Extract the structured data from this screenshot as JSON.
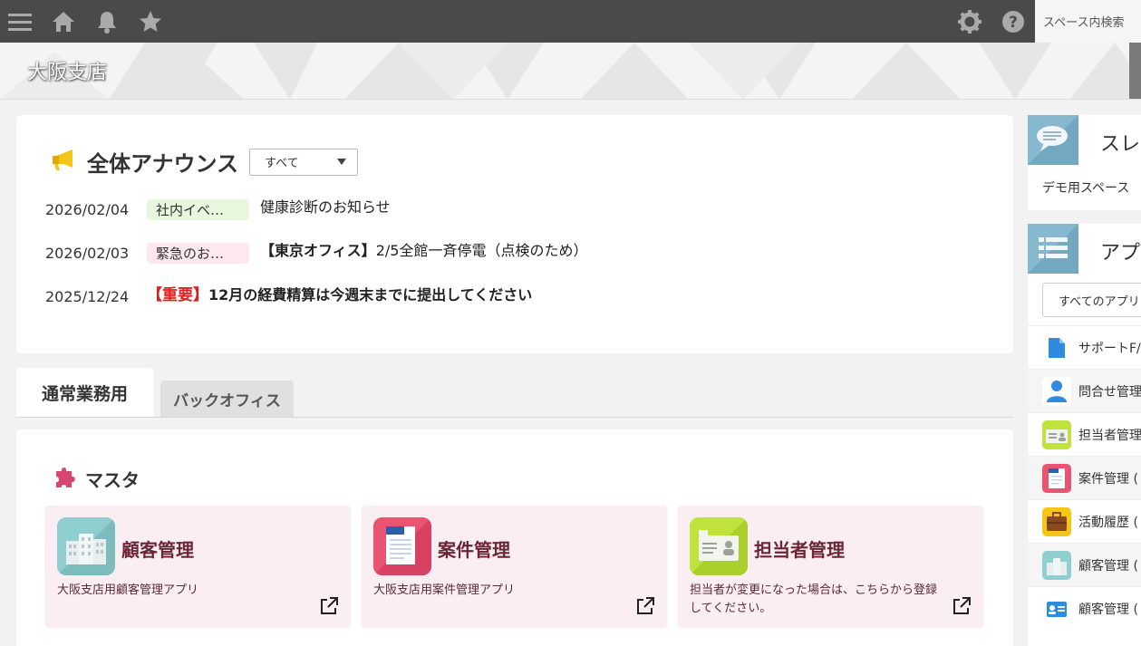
{
  "topbar": {
    "icons": [
      "menu-icon",
      "home-icon",
      "bell-icon",
      "star-icon",
      "gear-icon",
      "help-icon"
    ],
    "search_placeholder": "スペース内検索",
    "bg_color": "#4a4a4a"
  },
  "space": {
    "title": "大阪支店"
  },
  "announcement": {
    "title": "全体アナウンス",
    "filter_value": "すべて",
    "items": [
      {
        "date": "2026/02/04",
        "badge": "社内イベ…",
        "badge_color": "#e8f8de",
        "title": "健康診断のお知らせ"
      },
      {
        "date": "2026/02/03",
        "badge": "緊急のお…",
        "badge_color": "#fde8f0",
        "title_bold": "【東京オフィス】",
        "title": "2/5全館一斉停電（点検のため）"
      },
      {
        "date": "2025/12/24",
        "title_red": "【重要】",
        "title_bold": "12月の経費精算は今週末までに提出してください"
      }
    ]
  },
  "tabs": [
    {
      "label": "通常業務用",
      "active": true
    },
    {
      "label": "バックオフィス",
      "active": false
    }
  ],
  "section": {
    "title": "マスタ",
    "cards": [
      {
        "name": "顧客管理",
        "desc": "大阪支店用顧客管理アプリ",
        "icon": "building-icon"
      },
      {
        "name": "案件管理",
        "desc": "大阪支店用案件管理アプリ",
        "icon": "document-icon"
      },
      {
        "name": "担当者管理",
        "desc": "担当者が変更になった場合は、こちらから登録してください。",
        "icon": "id-card-icon"
      }
    ]
  },
  "sidebar": {
    "thread_title": "スレ",
    "thread_item": "デモ用スペース",
    "apps_title": "アプ",
    "apps_select": "すべてのアプリ",
    "apps": [
      {
        "label": "サポートF/",
        "icon": "file-icon"
      },
      {
        "label": "問合せ管理",
        "icon": "person-icon"
      },
      {
        "label": "担当者管理",
        "icon": "id-card-icon"
      },
      {
        "label": "案件管理 (",
        "icon": "document-icon"
      },
      {
        "label": "活動履歴 (",
        "icon": "briefcase-icon"
      },
      {
        "label": "顧客管理 (",
        "icon": "building-icon"
      },
      {
        "label": "顧客管理 (",
        "icon": "contact-card-icon"
      }
    ]
  }
}
